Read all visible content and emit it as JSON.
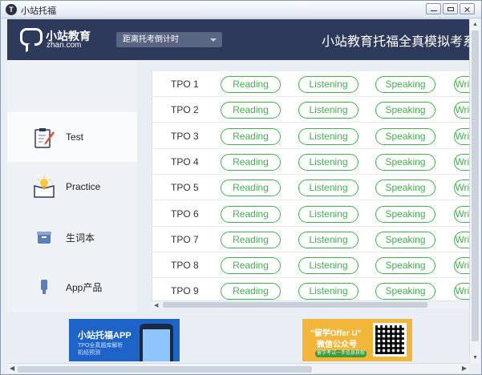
{
  "window": {
    "title": "小站托福",
    "app_icon_glyph": "T"
  },
  "header": {
    "logo_cn": "小站教育",
    "logo_en": "zhan.com",
    "dropdown": "距离托考倒计时",
    "title": "小站教育托福全真模拟考系统"
  },
  "sidebar": {
    "items": [
      {
        "label": "Test",
        "icon": "clipboard-pencil-icon",
        "active": true
      },
      {
        "label": "Practice",
        "icon": "lightbulb-book-icon",
        "active": false
      },
      {
        "label": "生词本",
        "icon": "vocabulary-box-icon",
        "active": false
      },
      {
        "label": "App产品",
        "icon": "mobile-app-icon",
        "active": false
      }
    ]
  },
  "tests": {
    "columns": [
      "Reading",
      "Listening",
      "Speaking",
      "Writing"
    ],
    "rows": [
      {
        "name": "TPO 1"
      },
      {
        "name": "TPO 2"
      },
      {
        "name": "TPO 3"
      },
      {
        "name": "TPO 4"
      },
      {
        "name": "TPO 5"
      },
      {
        "name": "TPO 6"
      },
      {
        "name": "TPO 7"
      },
      {
        "name": "TPO 8"
      },
      {
        "name": "TPO 9"
      }
    ]
  },
  "banners": {
    "app": {
      "title": "小站托福APP",
      "line1": "TPO全真题库解析",
      "line2": "机经预测"
    },
    "wechat": {
      "title": "\"留学Offer U\"",
      "subtitle": "微信公众号",
      "tag": "留学考试一手信息获取"
    }
  },
  "colors": {
    "accent_green": "#41b24c",
    "header_navy": "#2e3a5b"
  }
}
